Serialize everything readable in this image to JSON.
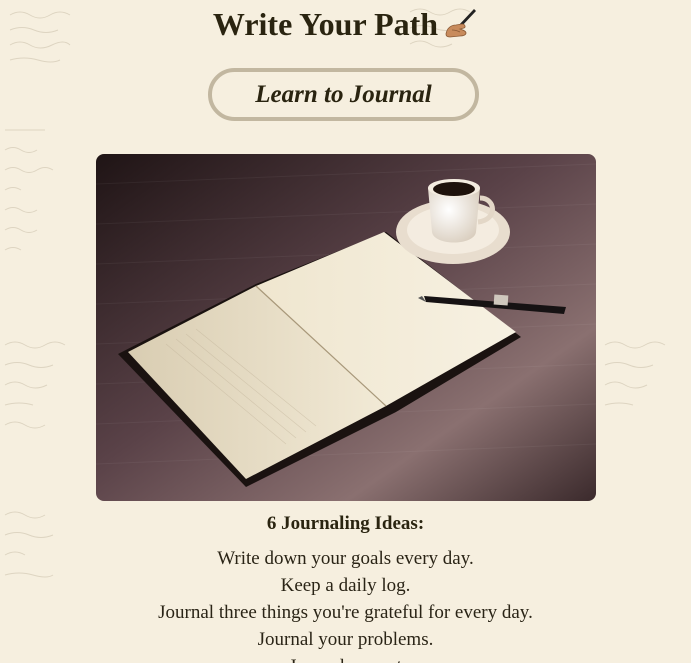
{
  "header": {
    "title": "Write Your Path",
    "title_icon": "writing-hand-icon"
  },
  "cta": {
    "label": "Learn to Journal"
  },
  "hero": {
    "image": "open-notebook-with-coffee-and-pen"
  },
  "ideas": {
    "heading": "6 Journaling Ideas:",
    "items": [
      "Write down your goals every day.",
      "Keep a daily log.",
      "Journal three things you're grateful for every day.",
      "Journal your problems.",
      "Journal your st"
    ]
  },
  "colors": {
    "background": "#f6efdf",
    "text": "#2a2410",
    "button_border": "#c2b7a0"
  }
}
